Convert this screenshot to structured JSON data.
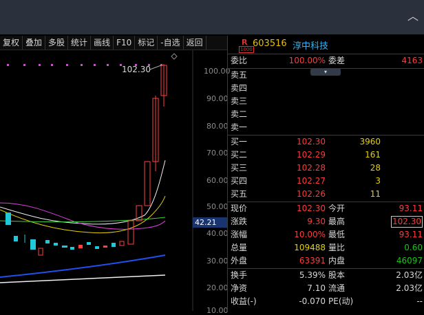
{
  "topbar": {
    "chevron": "chevron-up-icon"
  },
  "toolbar": {
    "buttons": [
      "复权",
      "叠加",
      "多股",
      "统计",
      "画线",
      "F10",
      "标记",
      "-自选",
      "返回"
    ]
  },
  "chart": {
    "price_label": "102.30",
    "current_price_tag": "42.21",
    "y_ticks": [
      "100.00",
      "90.00",
      "80.00",
      "70.00",
      "60.00",
      "50.00",
      "40.00",
      "30.00",
      "20.00",
      "10.00"
    ]
  },
  "stock": {
    "badge_letter": "R",
    "badge_num": "1000",
    "code": "603516",
    "name": "淳中科技"
  },
  "quote": {
    "wb_label": "委比",
    "wb_value": "100.00%",
    "wc_label": "委差",
    "wc_value": "4163",
    "dropdown": "▾",
    "sell": [
      {
        "label": "卖五",
        "price": "",
        "vol": ""
      },
      {
        "label": "卖四",
        "price": "",
        "vol": ""
      },
      {
        "label": "卖三",
        "price": "",
        "vol": ""
      },
      {
        "label": "卖二",
        "price": "",
        "vol": ""
      },
      {
        "label": "卖一",
        "price": "",
        "vol": ""
      }
    ],
    "buy": [
      {
        "label": "买一",
        "price": "102.30",
        "vol": "3960"
      },
      {
        "label": "买二",
        "price": "102.29",
        "vol": "161"
      },
      {
        "label": "买三",
        "price": "102.28",
        "vol": "28"
      },
      {
        "label": "买四",
        "price": "102.27",
        "vol": "3"
      },
      {
        "label": "买五",
        "price": "102.26",
        "vol": "11"
      }
    ],
    "stats": [
      {
        "l1": "现价",
        "v1": "102.30",
        "c1": "red",
        "l2": "今开",
        "v2": "93.11",
        "c2": "red"
      },
      {
        "l1": "涨跌",
        "v1": "9.30",
        "c1": "red",
        "l2": "最高",
        "v2": "102.30",
        "c2": "red"
      },
      {
        "l1": "涨幅",
        "v1": "10.00%",
        "c1": "red",
        "l2": "最低",
        "v2": "93.11",
        "c2": "red"
      },
      {
        "l1": "总量",
        "v1": "109488",
        "c1": "yel",
        "l2": "量比",
        "v2": "0.60",
        "c2": "grn"
      },
      {
        "l1": "外盘",
        "v1": "63391",
        "c1": "red",
        "l2": "内盘",
        "v2": "46097",
        "c2": "grn"
      }
    ],
    "fund": [
      {
        "l1": "换手",
        "v1": "5.39%",
        "l2": "股本",
        "v2": "2.03亿"
      },
      {
        "l1": "净资",
        "v1": "7.10",
        "l2": "流通",
        "v2": "2.03亿"
      },
      {
        "l1": "收益(-)",
        "v1": "-0.070",
        "l2": "PE(动)",
        "v2": "--"
      }
    ]
  }
}
